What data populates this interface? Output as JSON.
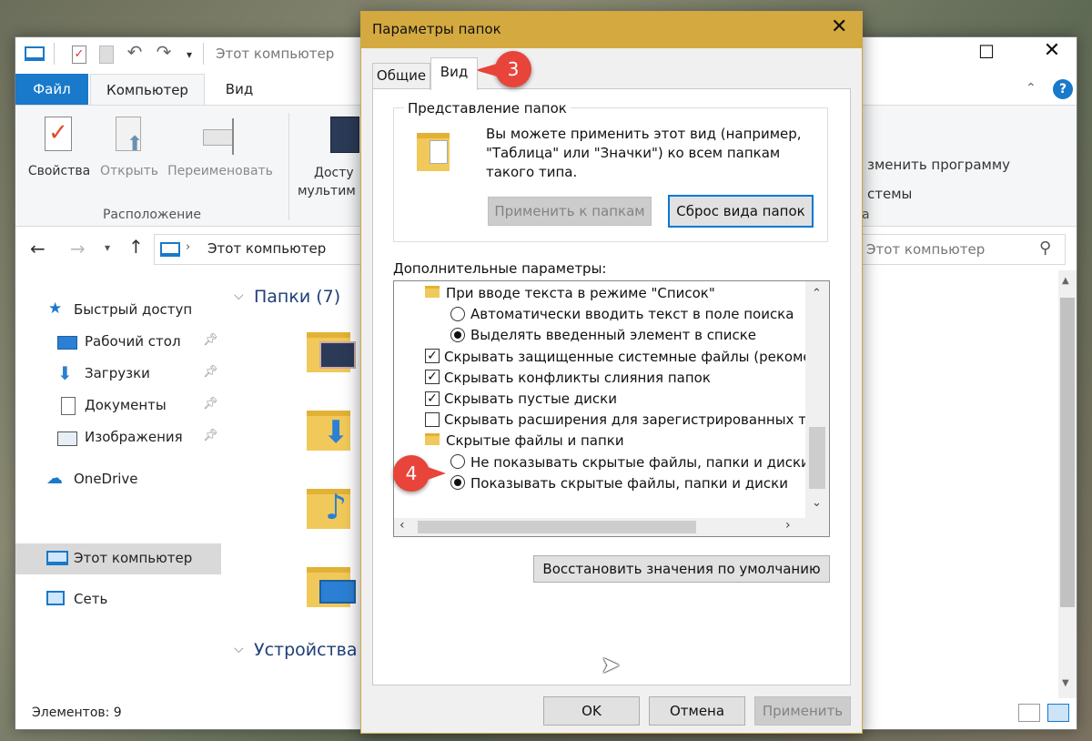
{
  "explorer": {
    "title": "Этот компьютер",
    "tabs": {
      "file": "Файл",
      "computer": "Компьютер",
      "view": "Вид"
    },
    "ribbon": {
      "properties": "Свойства",
      "open": "Открыть",
      "rename": "Переименовать",
      "media_line1": "Досту",
      "media_line2": "мультим",
      "group_location": "Расположение",
      "right_1": "зменить программу",
      "right_2": "стемы",
      "right_3": "а"
    },
    "address": {
      "path": "Этот компьютер",
      "search_placeholder": "Этот компьютер"
    },
    "sidebar": {
      "quick_access": "Быстрый доступ",
      "items": [
        {
          "label": "Рабочий стол"
        },
        {
          "label": "Загрузки"
        },
        {
          "label": "Документы"
        },
        {
          "label": "Изображения"
        }
      ],
      "onedrive": "OneDrive",
      "this_pc": "Этот компьютер",
      "network": "Сеть"
    },
    "content": {
      "folders_heading": "Папки (7)",
      "devices_heading": "Устройства"
    },
    "status": "Элементов: 9"
  },
  "dialog": {
    "title": "Параметры папок",
    "tabs": {
      "general": "Общие",
      "view": "Вид"
    },
    "folder_views": {
      "legend": "Представление папок",
      "text_line1": "Вы можете применить этот вид (например,",
      "text_line2": "\"Таблица\" или \"Значки\") ко всем папкам",
      "text_line3": "такого типа.",
      "apply_btn": "Применить к папкам",
      "reset_btn": "Сброс вида папок"
    },
    "advanced_label": "Дополнительные параметры:",
    "options": [
      {
        "kind": "folder",
        "label": "При вводе текста в режиме \"Список\""
      },
      {
        "kind": "radio",
        "checked": false,
        "label": "Автоматически вводить текст в поле поиска"
      },
      {
        "kind": "radio",
        "checked": true,
        "label": "Выделять введенный элемент в списке"
      },
      {
        "kind": "check",
        "checked": true,
        "label": "Скрывать защищенные системные файлы (рекомен,"
      },
      {
        "kind": "check",
        "checked": true,
        "label": "Скрывать конфликты слияния папок"
      },
      {
        "kind": "check",
        "checked": true,
        "label": "Скрывать пустые диски"
      },
      {
        "kind": "check",
        "checked": false,
        "label": "Скрывать расширения для зарегистрированных типо"
      },
      {
        "kind": "folder",
        "label": "Скрытые файлы и папки"
      },
      {
        "kind": "radio",
        "checked": false,
        "label": "Не показывать скрытые файлы, папки и диски"
      },
      {
        "kind": "radio",
        "checked": true,
        "label": "Показывать скрытые файлы, папки и диски"
      }
    ],
    "restore_btn": "Восстановить значения по умолчанию",
    "ok_btn": "OK",
    "cancel_btn": "Отмена",
    "apply_btn": "Применить"
  },
  "callouts": {
    "step3": "3",
    "step4": "4"
  },
  "colors": {
    "accent": "#1979ca",
    "dialog_title": "#d4a940",
    "callout": "#e8443a",
    "folder": "#f1c95a"
  }
}
